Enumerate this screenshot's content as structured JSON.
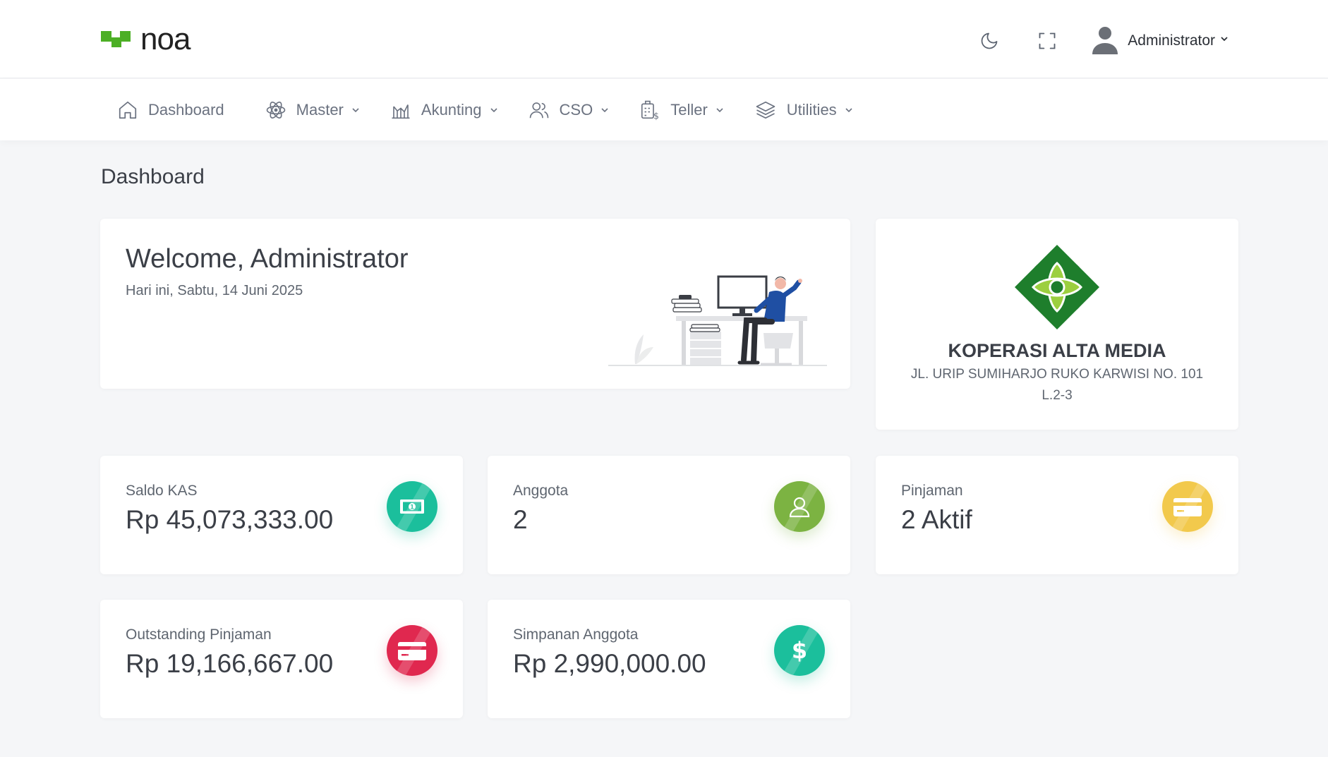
{
  "brand": {
    "name": "noa",
    "accent": "#4caf25"
  },
  "header": {
    "user_name": "Administrator",
    "icons": [
      "moon-icon",
      "fullscreen-icon",
      "user-avatar-icon"
    ]
  },
  "nav": {
    "items": [
      {
        "label": "Dashboard",
        "icon": "home-icon"
      },
      {
        "label": "Master",
        "icon": "atom-icon"
      },
      {
        "label": "Akunting",
        "icon": "chart-icon"
      },
      {
        "label": "CSO",
        "icon": "users-icon"
      },
      {
        "label": "Teller",
        "icon": "teller-icon"
      },
      {
        "label": "Utilities",
        "icon": "layers-icon"
      }
    ]
  },
  "page": {
    "title": "Dashboard"
  },
  "welcome": {
    "title": "Welcome, Administrator",
    "date": "Hari ini, Sabtu, 14 Juni 2025"
  },
  "org": {
    "name": "KOPERASI ALTA MEDIA",
    "address": "JL. URIP SUMIHARJO RUKO KARWISI NO. 101 L.2-3"
  },
  "stats": [
    {
      "label": "Saldo KAS",
      "value": "Rp 45,073,333.00",
      "icon": "money-icon",
      "color": "#1bbf9c"
    },
    {
      "label": "Anggota",
      "value": "2",
      "icon": "user-icon",
      "color": "#7cb342"
    },
    {
      "label": "Pinjaman",
      "value": "2 Aktif",
      "icon": "credit-card-icon",
      "color": "#f2c94c"
    },
    {
      "label": "Outstanding Pinjaman",
      "value": "Rp 19,166,667.00",
      "icon": "credit-card-icon",
      "color": "#e0284f"
    },
    {
      "label": "Simpanan Anggota",
      "value": "Rp 2,990,000.00",
      "icon": "dollar-icon",
      "color": "#1bbf9c"
    }
  ]
}
